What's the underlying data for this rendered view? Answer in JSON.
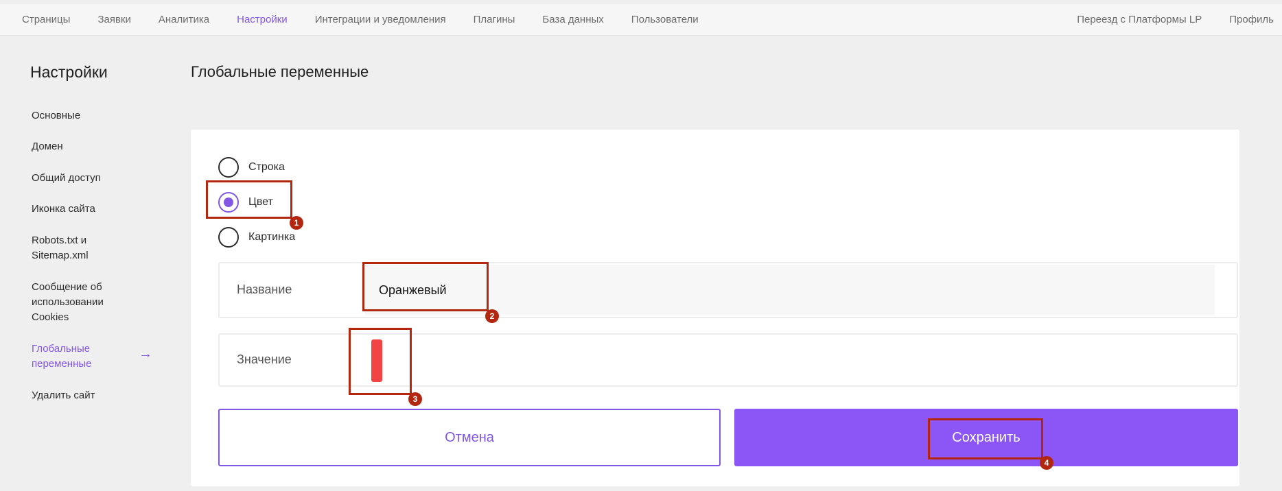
{
  "topnav": {
    "items": [
      "Страницы",
      "Заявки",
      "Аналитика",
      "Настройки",
      "Интеграции и уведомления",
      "Плагины",
      "База данных",
      "Пользователи"
    ],
    "active_index": 3,
    "right_items": [
      "Переезд с Платформы LP",
      "Профиль"
    ]
  },
  "sidebar": {
    "title": "Настройки",
    "items": [
      {
        "label": "Основные"
      },
      {
        "label": "Домен"
      },
      {
        "label": "Общий доступ"
      },
      {
        "label": "Иконка сайта"
      },
      {
        "label": "Robots.txt и Sitemap.xml"
      },
      {
        "label": "Сообщение об использовании Cookies"
      },
      {
        "label": "Глобальные переменные"
      },
      {
        "label": "Удалить сайт"
      }
    ],
    "active_index": 6,
    "arrow_icon": "arrow-right-icon"
  },
  "main": {
    "title": "Глобальные переменные",
    "types": [
      {
        "label": "Строка",
        "checked": false
      },
      {
        "label": "Цвет",
        "checked": true
      },
      {
        "label": "Картинка",
        "checked": false
      }
    ],
    "name_field": {
      "label": "Название",
      "value": "Оранжевый"
    },
    "value_field": {
      "label": "Значение",
      "color": "#f24444"
    },
    "cancel_label": "Отмена",
    "save_label": "Сохранить"
  },
  "annotations": [
    {
      "number": "1"
    },
    {
      "number": "2"
    },
    {
      "number": "3"
    },
    {
      "number": "4"
    }
  ],
  "colors": {
    "accent": "#8257e6",
    "save_button": "#8c55f6",
    "annotation": "#b3260f"
  }
}
